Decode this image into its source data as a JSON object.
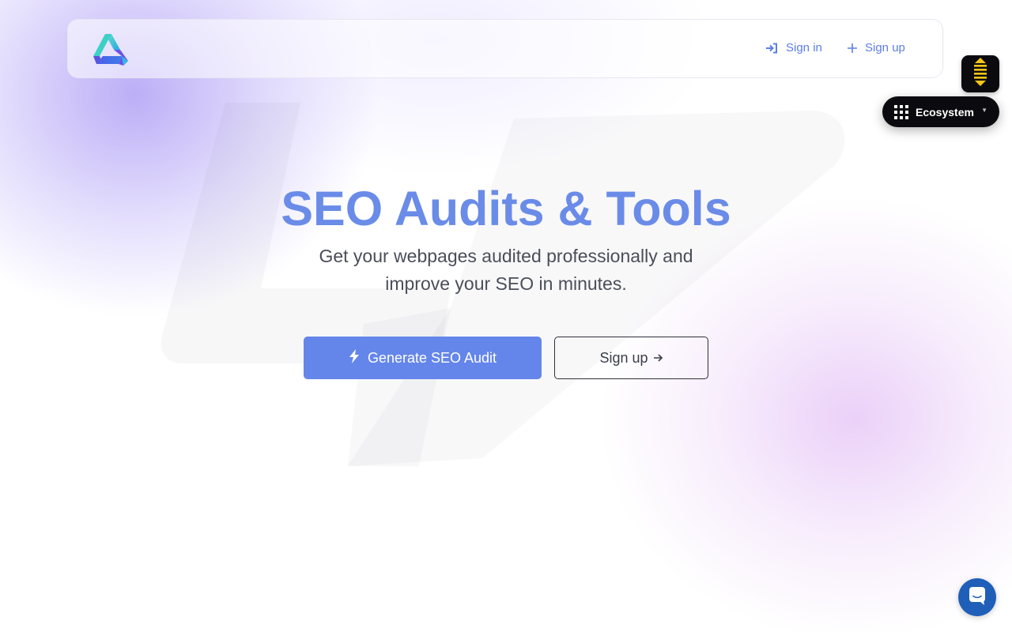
{
  "header": {
    "logo_icon": "brand-logo-icon",
    "nav": [
      {
        "label": "Sign in",
        "icon": "sign-in-icon"
      },
      {
        "label": "Sign up",
        "icon": "plus-icon"
      }
    ]
  },
  "widgets": {
    "scroll_icon": "scroll-arrows-icon",
    "ecosystem": {
      "label": "Ecosystem",
      "icon": "grid-icon",
      "caret": "▼"
    },
    "chat_icon": "chat-icon"
  },
  "hero": {
    "title": "SEO Audits & Tools",
    "subtitle": "Get your webpages audited professionally and improve your SEO in minutes.",
    "primary_button": {
      "label": "Generate SEO Audit",
      "icon": "bolt-icon"
    },
    "secondary_button": {
      "label": "Sign up",
      "icon": "arrow-right-icon"
    }
  },
  "colors": {
    "accent": "#6a8ce8",
    "primary_button": "#6486ea",
    "dark_widget": "#0b0b0f",
    "chat_launcher": "#1f5fb8",
    "scroll_icon": "#f5c518"
  }
}
